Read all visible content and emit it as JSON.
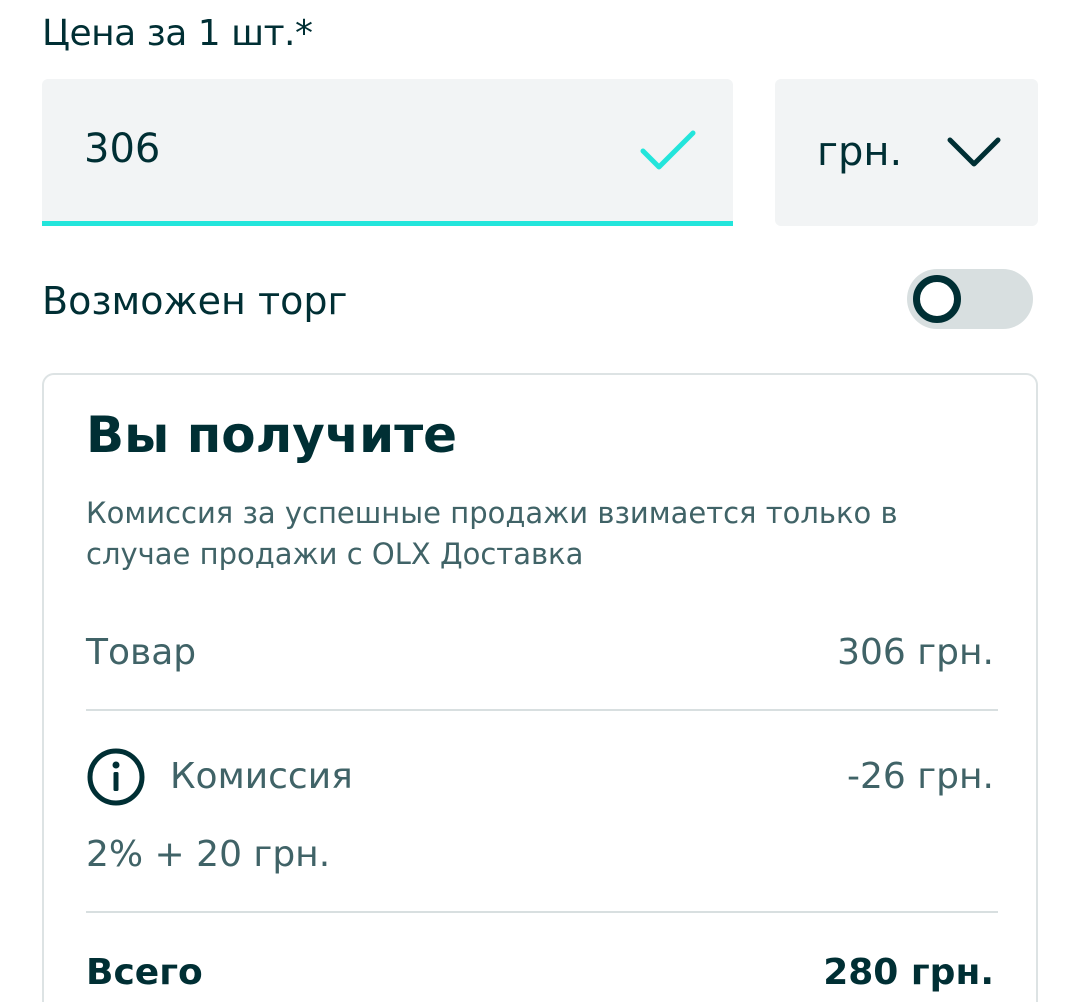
{
  "price": {
    "label": "Цена за 1 шт.*",
    "value": "306",
    "currency": "грн."
  },
  "bargain": {
    "label": "Возможен торг",
    "enabled": false
  },
  "summary": {
    "title": "Вы получите",
    "description": "Комиссия за успешные продажи взимается только в случае продажи с OLX Доставка",
    "item_label": "Товар",
    "item_value": "306 грн.",
    "commission_label": "Комиссия",
    "commission_value": "-26 грн.",
    "commission_formula": "2% + 20 грн.",
    "total_label": "Всего",
    "total_value": "280 грн."
  },
  "colors": {
    "accent": "#23e5db",
    "text_primary": "#002f34",
    "text_secondary": "#406367",
    "field_bg": "#f2f4f5"
  },
  "icons": [
    "check-icon",
    "chevron-down-icon",
    "info-icon"
  ]
}
